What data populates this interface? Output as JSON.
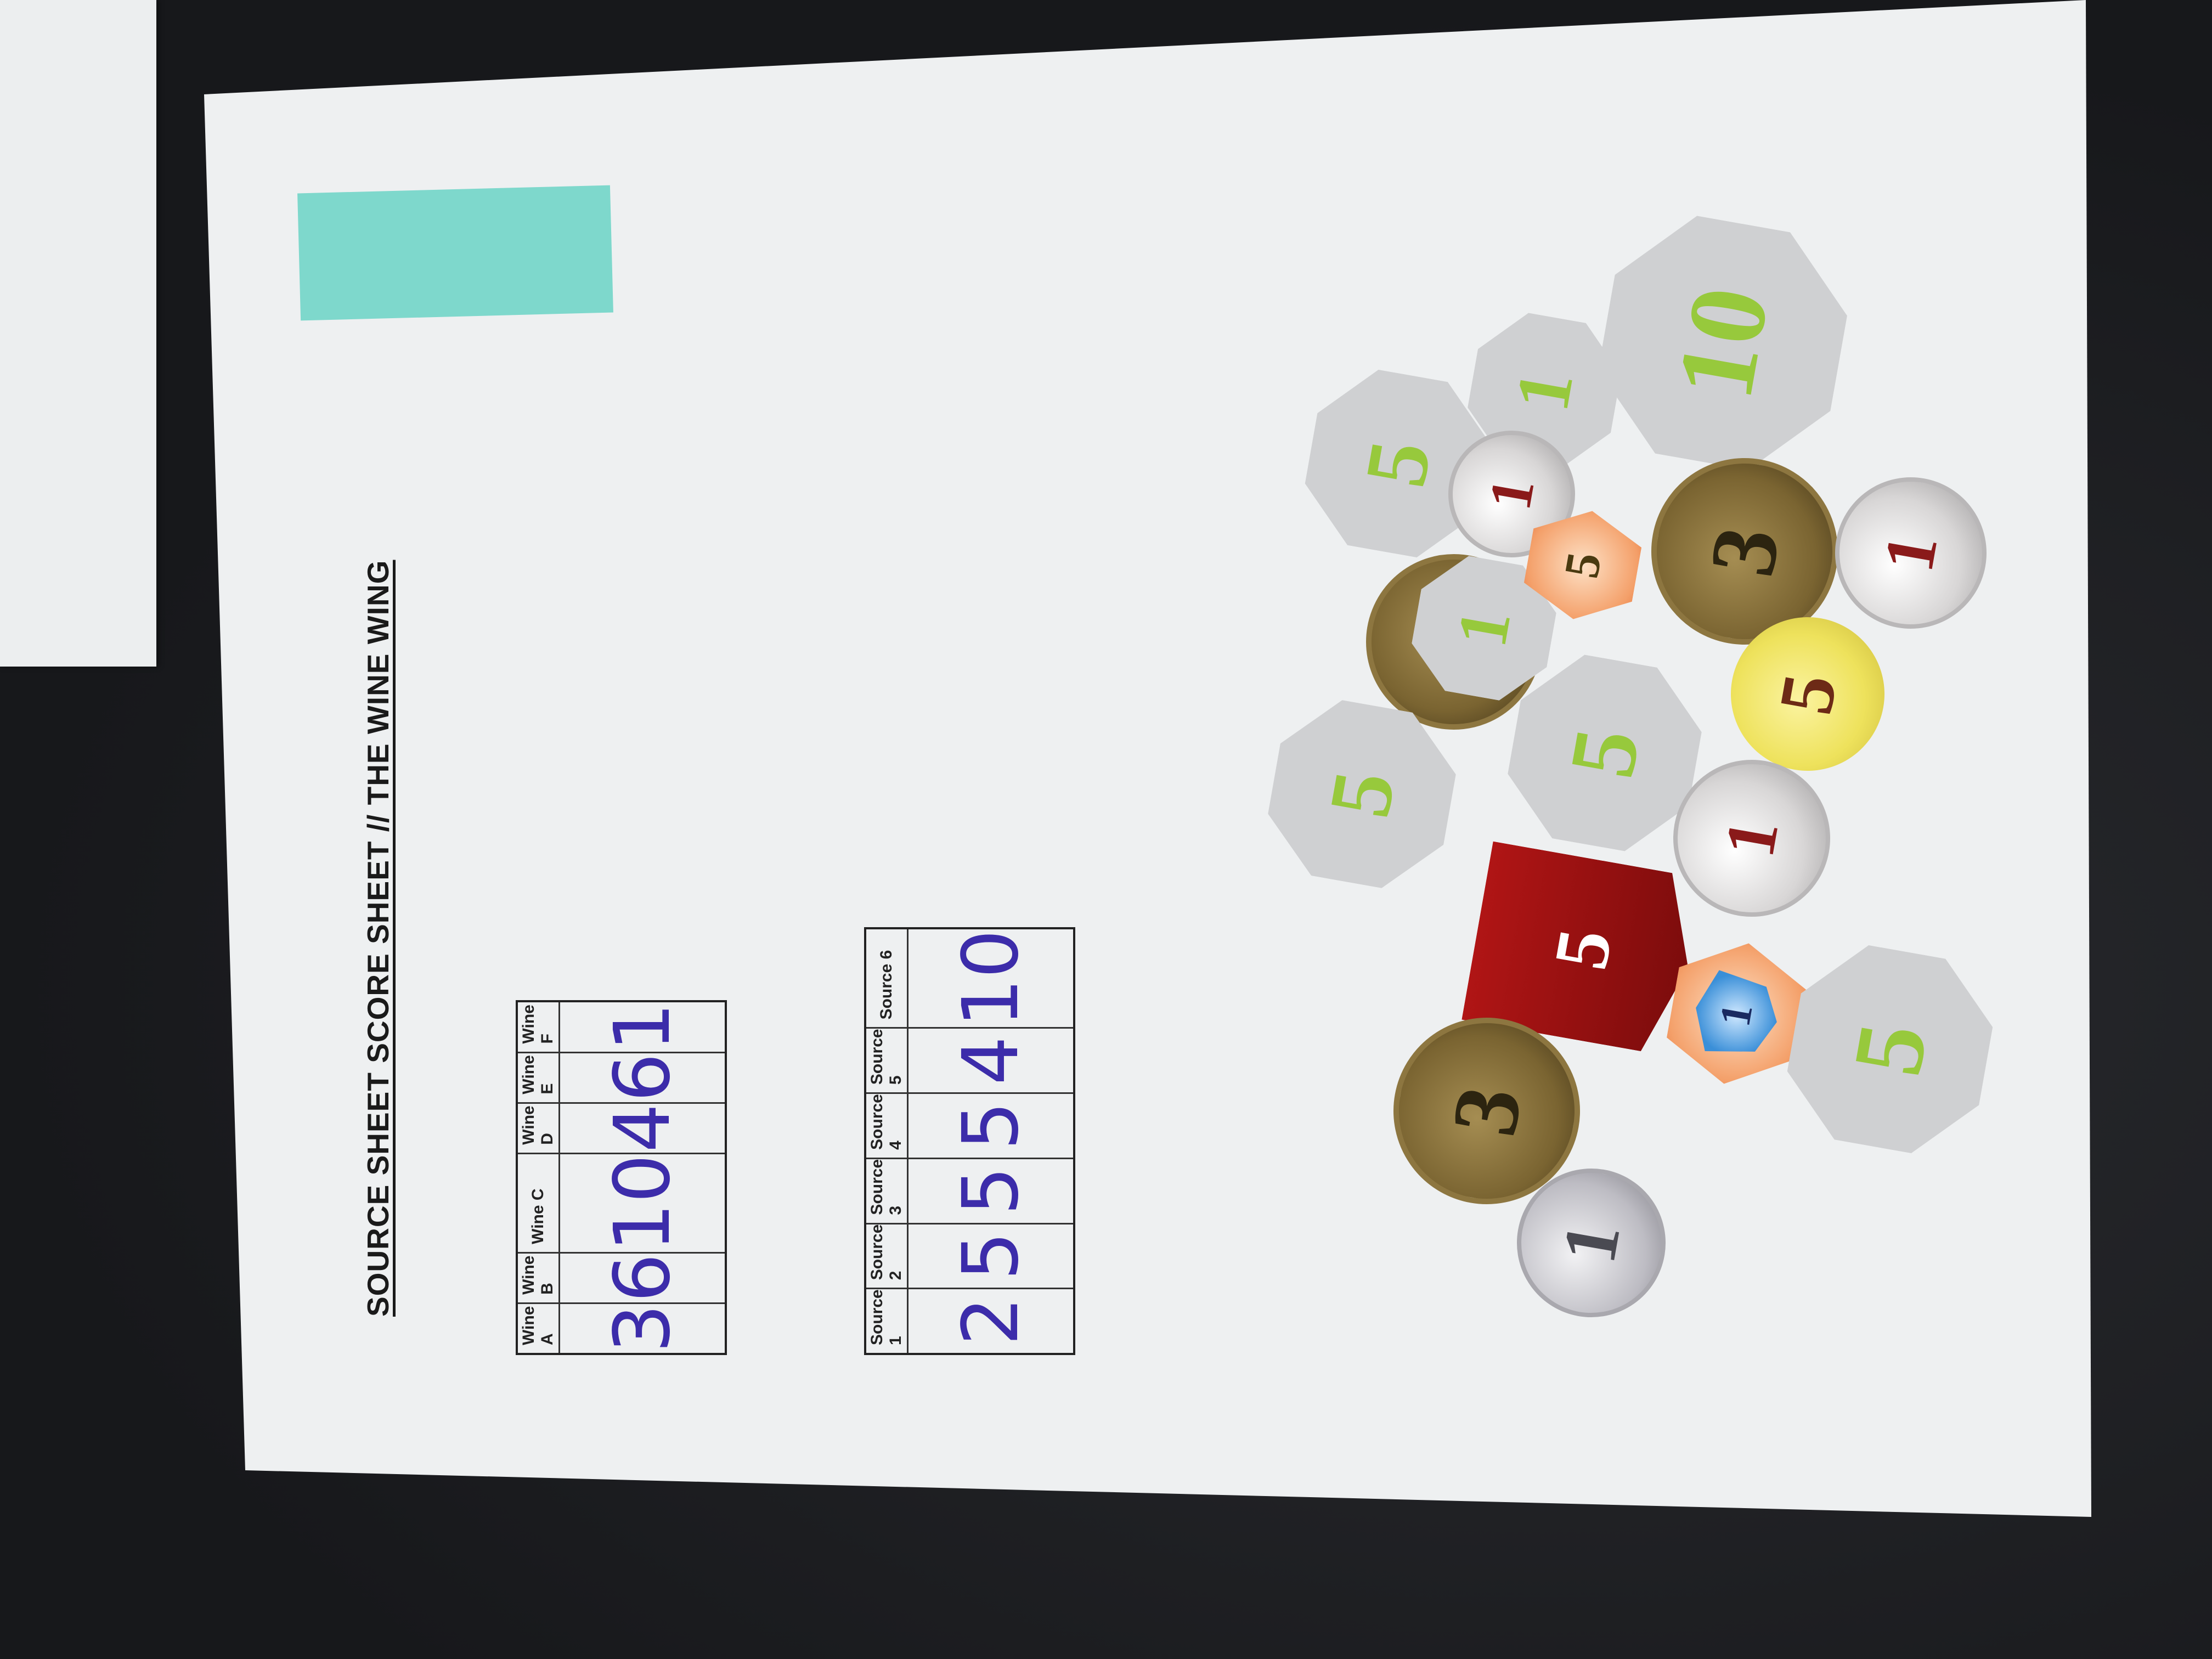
{
  "sheet": {
    "title": "SOURCE SHEET SCORE SHEET // THE WINE WING"
  },
  "wine_table": {
    "headers": [
      "Wine A",
      "Wine B",
      "Wine C",
      "Wine D",
      "Wine E",
      "Wine F"
    ],
    "values": [
      "3",
      "6",
      "10",
      "4",
      "6",
      "1"
    ]
  },
  "source_table": {
    "headers": [
      "Source 1",
      "Source 2",
      "Source 3",
      "Source 4",
      "Source 5",
      "Source 6"
    ],
    "values": [
      "2",
      "5",
      "5",
      "5",
      "4",
      "10"
    ]
  },
  "tokens": {
    "oct_10": "10",
    "oct_1a": "1",
    "oct_5a": "5",
    "oct_1b": "1",
    "oct_5b": "5",
    "oct_5c": "5",
    "oct_5d": "5",
    "silver_1a": "1",
    "silver_1b": "1",
    "silver_1c": "1",
    "gold_3a": "3",
    "gold_3b": "3",
    "yellow_5": "5",
    "hex_5": "5",
    "shield_1": "1",
    "banner_5": "5",
    "plain_silver_1": "1"
  },
  "colors": {
    "ink": "#3c2caa",
    "tape": "#7ed8cc",
    "token_number_green": "#97c93c"
  }
}
